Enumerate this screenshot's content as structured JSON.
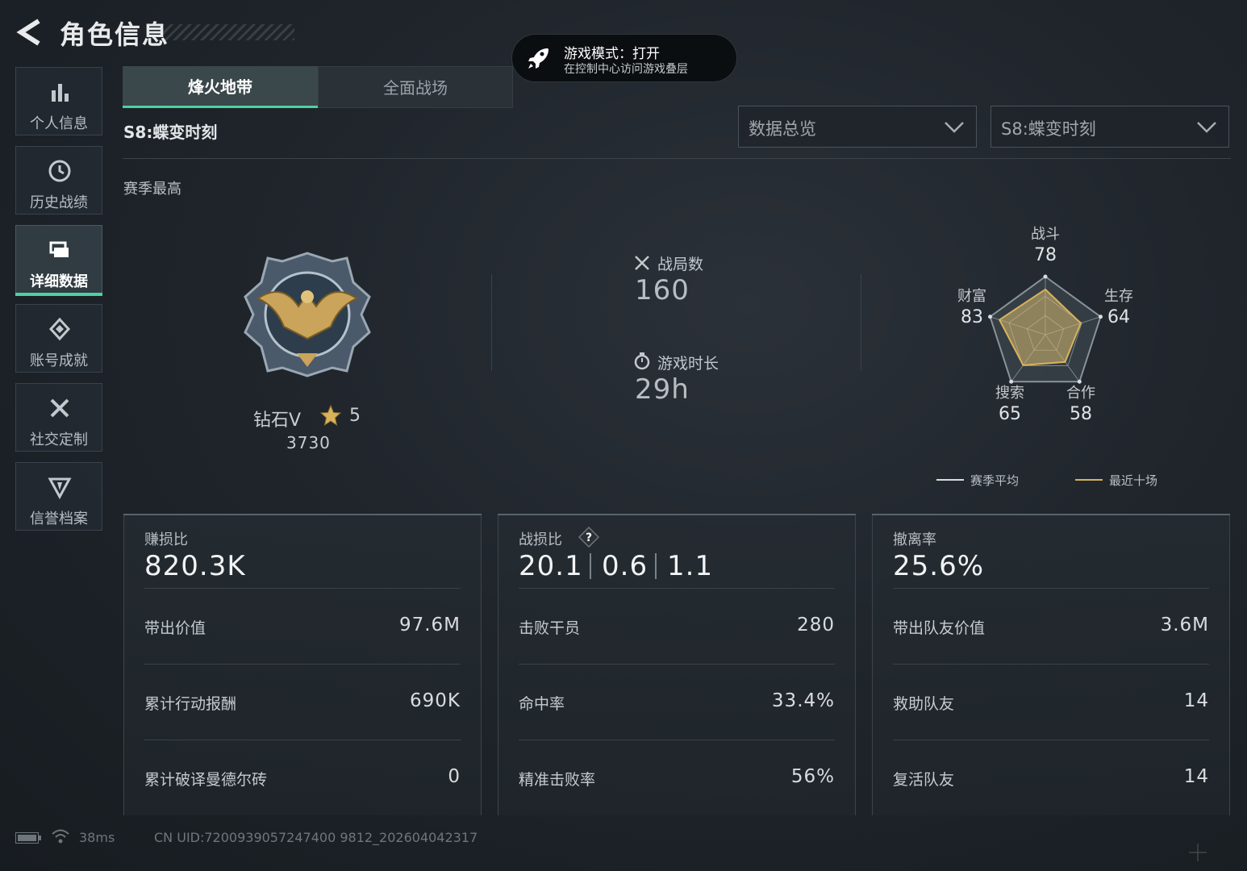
{
  "header": {
    "title": "角色信息"
  },
  "toast": {
    "title": "游戏模式：打开",
    "subtitle": "在控制中心访问游戏叠层"
  },
  "sidebar": {
    "items": [
      {
        "label": "个人信息",
        "icon": "bar-chart-icon"
      },
      {
        "label": "历史战绩",
        "icon": "history-clock-icon"
      },
      {
        "label": "详细数据",
        "icon": "detail-cards-icon",
        "active": true
      },
      {
        "label": "账号成就",
        "icon": "achievement-icon"
      },
      {
        "label": "社交定制",
        "icon": "crossed-tools-icon"
      },
      {
        "label": "信誉档案",
        "icon": "reputation-shield-icon"
      }
    ]
  },
  "tabs": [
    {
      "label": "烽火地带",
      "active": true
    },
    {
      "label": "全面战场",
      "active": false
    }
  ],
  "season_label": "S8:蝶变时刻",
  "dropdowns": {
    "view": "数据总览",
    "season": "S8:蝶变时刻"
  },
  "section_label": "赛季最高",
  "rank": {
    "name": "钻石V",
    "stars": "5",
    "score": "3730"
  },
  "stats": {
    "matches_label": "战局数",
    "matches_value": "160",
    "playtime_label": "游戏时长",
    "playtime_value": "29h"
  },
  "radar": {
    "axes": [
      {
        "label": "战斗",
        "value": "78"
      },
      {
        "label": "生存",
        "value": "64"
      },
      {
        "label": "合作",
        "value": "58"
      },
      {
        "label": "搜索",
        "value": "65"
      },
      {
        "label": "财富",
        "value": "83"
      }
    ],
    "legend": {
      "season_avg": "赛季平均",
      "recent": "最近十场"
    },
    "colors": {
      "season_avg": "#d9dde0",
      "recent": "#d8b35a"
    }
  },
  "cards": {
    "profit": {
      "label": "赚损比",
      "value": "820.3K",
      "rows": [
        {
          "label": "带出价值",
          "value": "97.6M"
        },
        {
          "label": "累计行动报酬",
          "value": "690K"
        },
        {
          "label": "累计破译曼德尔砖",
          "value": "0"
        }
      ]
    },
    "kd": {
      "label": "战损比",
      "help": "?",
      "values": [
        "20.1",
        "0.6",
        "1.1"
      ],
      "rows": [
        {
          "label": "击败干员",
          "value": "280"
        },
        {
          "label": "命中率",
          "value": "33.4%"
        },
        {
          "label": "精准击败率",
          "value": "56%"
        }
      ]
    },
    "extract": {
      "label": "撤离率",
      "value": "25.6%",
      "rows": [
        {
          "label": "带出队友价值",
          "value": "3.6M"
        },
        {
          "label": "救助队友",
          "value": "14"
        },
        {
          "label": "复活队友",
          "value": "14"
        }
      ]
    }
  },
  "footer": {
    "ping": "38ms",
    "uid": "CN UID:7200939057247400 9812_202604042317"
  },
  "accent_color": "#4fd1a1"
}
